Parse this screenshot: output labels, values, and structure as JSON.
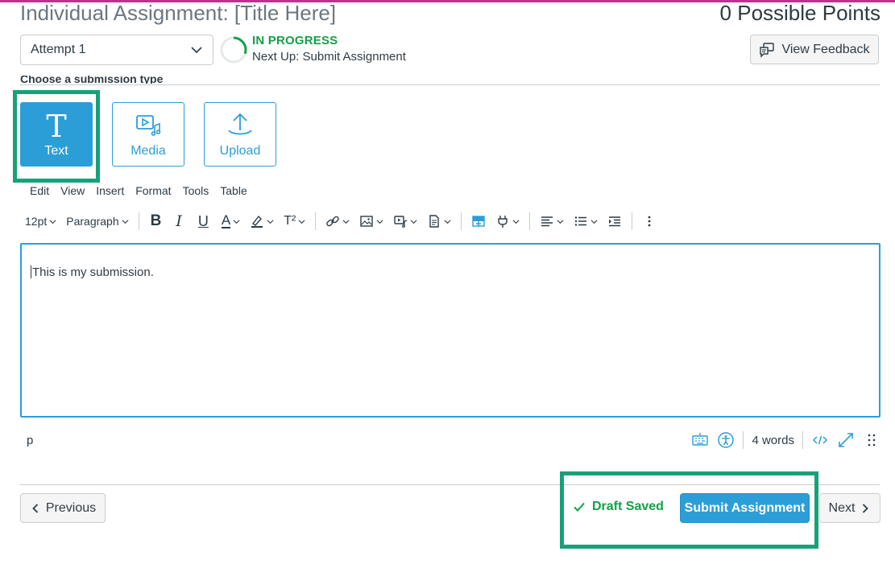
{
  "header": {
    "title": "Individual Assignment: [Title Here]",
    "points": "0 Possible Points"
  },
  "attempt": {
    "selected": "Attempt 1"
  },
  "progress": {
    "status": "IN PROGRESS",
    "next_up": "Next Up: Submit Assignment",
    "ring_fraction": 0.3
  },
  "feedback": {
    "label": "View Feedback"
  },
  "submission_types": {
    "label": "Choose a submission type",
    "items": [
      {
        "label": "Text",
        "icon": "text-t-icon",
        "active": true
      },
      {
        "label": "Media",
        "icon": "media-icon",
        "active": false
      },
      {
        "label": "Upload",
        "icon": "upload-icon",
        "active": false
      }
    ]
  },
  "editor": {
    "menu": [
      "Edit",
      "View",
      "Insert",
      "Format",
      "Tools",
      "Table"
    ],
    "toolbar": {
      "font_size": "12pt",
      "block_format": "Paragraph",
      "bold": "B",
      "italic": "I",
      "underline": "U",
      "text_color": "A",
      "superscript": "T²"
    },
    "content": "This is my submission.",
    "status": {
      "path": "p",
      "word_count": "4 words"
    }
  },
  "footer": {
    "previous_label": "Previous",
    "draft_status": "Draft Saved",
    "submit_label": "Submit Assignment",
    "next_label": "Next"
  },
  "colors": {
    "accent": "#2b9ed8",
    "success": "#13a047",
    "highlight": "#17a17a",
    "top_bar": "#c2308f"
  }
}
